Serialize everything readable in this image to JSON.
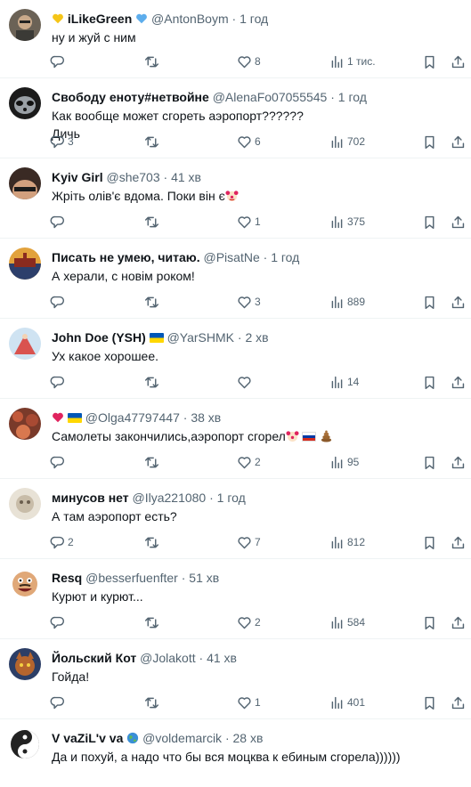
{
  "tweets": [
    {
      "name": "iLikeGreen",
      "handle": "@AntonBoym",
      "time": "1 год",
      "text": "ну и жуй с ним",
      "replies": "",
      "retweets": "",
      "likes": "8",
      "views": "1 тис."
    },
    {
      "name": "Свободу еноту#нетвойне",
      "handle": "@AlenaFo07055545",
      "time": "1 год",
      "text": "Как вообще может сгореть аэропорт??????\nДичь",
      "replies": "3",
      "retweets": "",
      "likes": "6",
      "views": "702"
    },
    {
      "name": "Kyiv Girl",
      "handle": "@she703",
      "time": "41 хв",
      "text": "Жріть олів'є вдома. Поки він є",
      "replies": "",
      "retweets": "",
      "likes": "1",
      "views": "375"
    },
    {
      "name": "Писать не умею, читаю.",
      "handle": "@PisatNe",
      "time": "1 год",
      "text": "А херали, с новім роком!",
      "replies": "",
      "retweets": "",
      "likes": "3",
      "views": "889"
    },
    {
      "name": "John Doe (YSH)",
      "handle": "@YarSHMK",
      "time": "2 хв",
      "text": "Ух какое хорошее.",
      "replies": "",
      "retweets": "",
      "likes": "",
      "views": "14"
    },
    {
      "name": "",
      "handle": "@Olga47797447",
      "time": "38 хв",
      "text": "Самолеты закончились,аэропорт сгорел",
      "replies": "",
      "retweets": "",
      "likes": "2",
      "views": "95"
    },
    {
      "name": "минусов нет",
      "handle": "@Ilya221080",
      "time": "1 год",
      "text": "А там аэропорт есть?",
      "replies": "2",
      "retweets": "",
      "likes": "7",
      "views": "812"
    },
    {
      "name": "Resq",
      "handle": "@besserfuenfter",
      "time": "51 хв",
      "text": "Курют и курют...",
      "replies": "",
      "retweets": "",
      "likes": "2",
      "views": "584"
    },
    {
      "name": "Йольский Кот",
      "handle": "@Jolakott",
      "time": "41 хв",
      "text": "Гойда!",
      "replies": "",
      "retweets": "",
      "likes": "1",
      "views": "401"
    },
    {
      "name": "V vaZiL'v va",
      "handle": "@voldemarcik",
      "time": "28 хв",
      "text": "Да и похуй, а надо что бы вся моцква к ебиным сгорела))))))",
      "replies": "",
      "retweets": "",
      "likes": "",
      "views": ""
    }
  ],
  "dot": "·"
}
